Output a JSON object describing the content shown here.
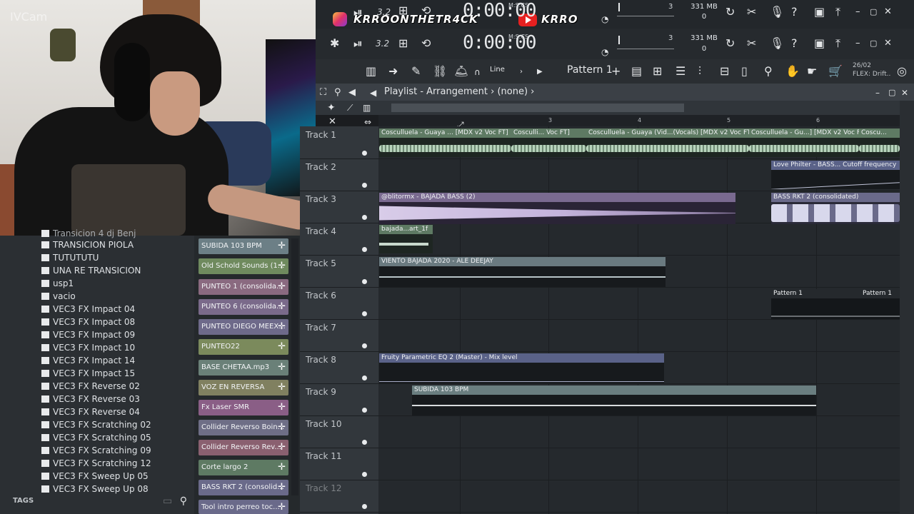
{
  "webcam": {
    "label": "IVCam"
  },
  "overlay": {
    "instagram_handle": "KRROONTHETR4CK",
    "youtube_name": "KRRO"
  },
  "transport": {
    "tempo_top": "3.2",
    "tempo_bottom": "3.2",
    "time_top": "0:00:00",
    "time_bottom": "0:00:00",
    "time_unit": "M:S:CS",
    "cpu_top": "3",
    "cpu_bottom": "3",
    "mem_top": "331 MB",
    "mem_bottom": "331 MB",
    "poly_top": "0",
    "poly_bottom": "0"
  },
  "toolbar": {
    "snap_mode": "Line",
    "pattern": "Pattern 1",
    "pattern_add": "+",
    "date": "26/02",
    "news": "FLEX: Drift.."
  },
  "playlist": {
    "title": "Playlist - Arrangement",
    "breadcrumb_sep": "›",
    "selection": "(none)",
    "ruler": [
      "3",
      "4",
      "5",
      "6"
    ],
    "tracks": [
      "Track 1",
      "Track 2",
      "Track 3",
      "Track 4",
      "Track 5",
      "Track 6",
      "Track 7",
      "Track 8",
      "Track 9",
      "Track 10",
      "Track 11",
      "Track 12"
    ],
    "clips": [
      {
        "track": 1,
        "label": "Cosculluela - Guaya ... [MDX v2 Voc FT]",
        "color": "#5e7a63"
      },
      {
        "track": 1,
        "label": "Cosculli... Voc FT]",
        "color": "#5e7a63"
      },
      {
        "track": 1,
        "label": "Cosculluela - Guaya (Vid...(Vocals) [MDX v2 Voc FT]",
        "color": "#5e7a63"
      },
      {
        "track": 1,
        "label": "Cosculluela - Gu...] [MDX v2 Voc FT]",
        "color": "#5e7a63"
      },
      {
        "track": 1,
        "label": "Coscu...",
        "color": "#5e7a63"
      },
      {
        "track": 2,
        "label": "Love Philter - BASS... Cutoff frequency",
        "color": "#5a6288"
      },
      {
        "track": 3,
        "label": "@blitormx - BAJADA BASS (2)",
        "color": "#7a6a90"
      },
      {
        "track": 3,
        "label": "BASS RKT 2 (consolidated)",
        "color": "#6a6a8a"
      },
      {
        "track": 4,
        "label": "bajada...art_1f",
        "color": "#5e7a63"
      },
      {
        "track": 5,
        "label": "VIENTO BAJADA 2020 - ALE DEEJAY",
        "color": "#6a7a80"
      },
      {
        "track": 6,
        "label": "Pattern 1",
        "color": "#2a2e32"
      },
      {
        "track": 6,
        "label": "Pattern 1",
        "color": "#2a2e32"
      },
      {
        "track": 8,
        "label": "Fruity Parametric EQ 2 (Master) - Mix level",
        "color": "#5a6288"
      },
      {
        "track": 9,
        "label": "SUBIDA 103 BPM",
        "color": "#6a7e80"
      }
    ]
  },
  "browser": {
    "items": [
      "Transicion 4 dj Benj",
      "TRANSICION PIOLA",
      "TUTUTUTU",
      "UNA RE TRANSICION",
      "usp1",
      "vacio",
      "VEC3 FX Impact 04",
      "VEC3 FX Impact 08",
      "VEC3 FX Impact 09",
      "VEC3 FX Impact 10",
      "VEC3 FX Impact 14",
      "VEC3 FX Impact 15",
      "VEC3 FX Reverse 02",
      "VEC3 FX Reverse 03",
      "VEC3 FX Reverse 04",
      "VEC3 FX Scratching 02",
      "VEC3 FX Scratching 05",
      "VEC3 FX Scratching 09",
      "VEC3 FX Scratching 12",
      "VEC3 FX Sweep Up 05",
      "VEC3 FX Sweep Up 08"
    ],
    "tags_label": "TAGS"
  },
  "channels": {
    "items": [
      {
        "label": "SUBIDA 103 BPM",
        "color": "#6c7f86"
      },
      {
        "label": "Old Schold Sounds (1...",
        "color": "#6f8a5e"
      },
      {
        "label": "PUNTEO 1 (consolida...",
        "color": "#8a6a80"
      },
      {
        "label": "PUNTEO 6 (consolida...",
        "color": "#7a6a8a"
      },
      {
        "label": "PUNTEO DIEGO MEEX...",
        "color": "#6e6a8a"
      },
      {
        "label": "PUNTEO22",
        "color": "#7b8a5c"
      },
      {
        "label": "BASE CHETAA.mp3",
        "color": "#6a8078"
      },
      {
        "label": "VOZ EN REVERSA",
        "color": "#808060"
      },
      {
        "label": "Fx Laser SMR",
        "color": "#8a5e86"
      },
      {
        "label": "Collider Reverso Boin...",
        "color": "#6e6e86"
      },
      {
        "label": "Collider Reverso Rev...",
        "color": "#8a6070"
      },
      {
        "label": "Corte largo 2",
        "color": "#5e7a63"
      },
      {
        "label": "BASS RKT 2 (consolid...",
        "color": "#6a6a8a"
      },
      {
        "label": "Tool intro perreo toc...",
        "color": "#6a6a8a"
      }
    ]
  }
}
